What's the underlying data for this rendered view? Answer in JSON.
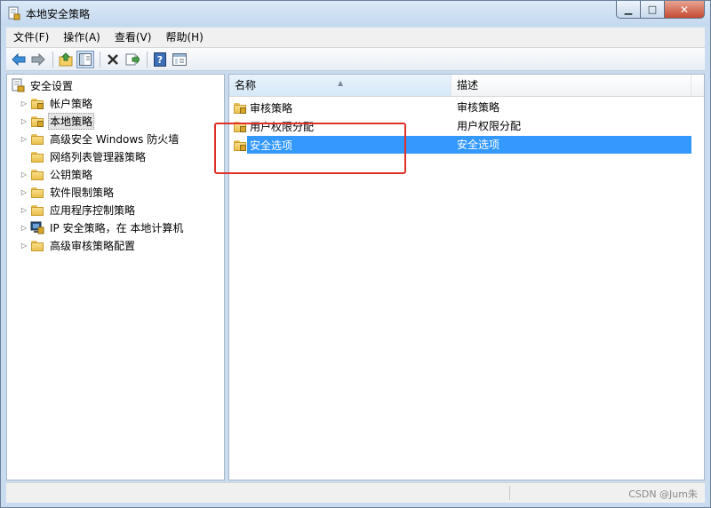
{
  "window": {
    "title": "本地安全策略"
  },
  "menu": [
    "文件(F)",
    "操作(A)",
    "查看(V)",
    "帮助(H)"
  ],
  "toolbar": [
    {
      "icon": "back-arrow-icon"
    },
    {
      "icon": "forward-arrow-icon"
    },
    {
      "icon": "up-folder-icon"
    },
    {
      "icon": "show-hide-tree-icon"
    },
    {
      "icon": "delete-x-icon"
    },
    {
      "icon": "export-list-icon"
    },
    {
      "icon": "help-icon"
    },
    {
      "icon": "properties-icon"
    }
  ],
  "tree": {
    "root": "安全设置",
    "items": [
      {
        "label": "帐户策略",
        "expander": true,
        "icon": "lock-folder-icon",
        "selected": false
      },
      {
        "label": "本地策略",
        "expander": true,
        "icon": "lock-folder-icon",
        "selected": true
      },
      {
        "label": "高级安全 Windows 防火墙",
        "expander": true,
        "icon": "folder-icon",
        "selected": false
      },
      {
        "label": "网络列表管理器策略",
        "expander": false,
        "icon": "folder-icon",
        "selected": false
      },
      {
        "label": "公钥策略",
        "expander": true,
        "icon": "folder-icon",
        "selected": false
      },
      {
        "label": "软件限制策略",
        "expander": true,
        "icon": "folder-icon",
        "selected": false
      },
      {
        "label": "应用程序控制策略",
        "expander": true,
        "icon": "folder-icon",
        "selected": false
      },
      {
        "label": "IP 安全策略，在 本地计算机",
        "expander": true,
        "icon": "ip-security-icon",
        "selected": false
      },
      {
        "label": "高级审核策略配置",
        "expander": true,
        "icon": "folder-icon",
        "selected": false
      }
    ]
  },
  "list": {
    "columns": {
      "name": "名称",
      "description": "描述"
    },
    "rows": [
      {
        "name": "审核策略",
        "description": "审核策略",
        "selected": false
      },
      {
        "name": "用户权限分配",
        "description": "用户权限分配",
        "selected": false
      },
      {
        "name": "安全选项",
        "description": "安全选项",
        "selected": true
      }
    ]
  },
  "statusbar": {
    "watermark": "CSDN @Jum朱"
  },
  "colors": {
    "selection": "#3399ff",
    "annotation": "#e0302a"
  }
}
